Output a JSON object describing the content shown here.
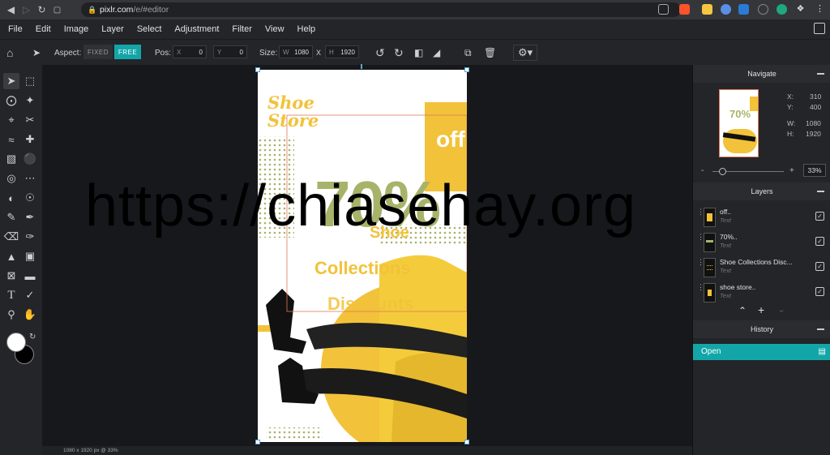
{
  "browser": {
    "url_domain": "pixlr.com",
    "url_path": "/e/#editor"
  },
  "menu": [
    "File",
    "Edit",
    "Image",
    "Layer",
    "Select",
    "Adjustment",
    "Filter",
    "View",
    "Help"
  ],
  "toolbar": {
    "aspect_label": "Aspect:",
    "fixed_label": "FIXED",
    "free_label": "FREE",
    "pos_label": "Pos:",
    "pos_x_prefix": "X",
    "pos_x_value": "0",
    "pos_y_prefix": "Y",
    "pos_y_value": "0",
    "size_label": "Size:",
    "size_w_prefix": "W",
    "size_w_value": "1080",
    "size_x_sep": "X",
    "size_h_prefix": "H",
    "size_h_value": "1920"
  },
  "navigate": {
    "title": "Navigate",
    "x_label": "X:",
    "x_value": "310",
    "y_label": "Y:",
    "y_value": "400",
    "w_label": "W:",
    "w_value": "1080",
    "h_label": "H:",
    "h_value": "1920",
    "zoom_minus": "-",
    "zoom_plus": "+",
    "zoom_value": "33%",
    "zoom_level": 0.33
  },
  "layers": {
    "title": "Layers",
    "items": [
      {
        "name": "off..",
        "type": "Text"
      },
      {
        "name": "70%..",
        "type": "Text"
      },
      {
        "name": "Shoe Collections Disc...",
        "type": "Text"
      },
      {
        "name": "shoe store..",
        "type": "Text"
      }
    ]
  },
  "history": {
    "title": "History",
    "items": [
      "Open"
    ]
  },
  "status": "1080 x 1920 px @ 33%",
  "document": {
    "shoe_store": "Shoe Store",
    "off": "off",
    "percent": "70%",
    "shoe": "Shoe",
    "collections": "Collections",
    "discounts": "Discounts"
  },
  "watermark": "https://chiasehay.org",
  "colors": {
    "accent": "#13a6a8",
    "yellow": "#f2c23a",
    "olive": "#a8b36a"
  }
}
